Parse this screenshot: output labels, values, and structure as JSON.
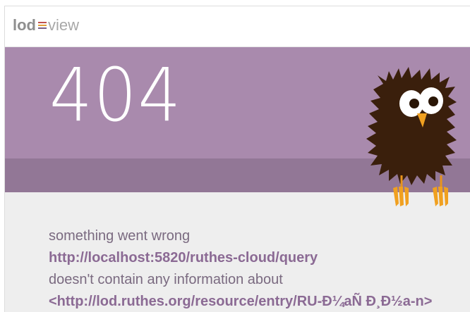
{
  "header": {
    "logo_left": "lod",
    "logo_right": "view",
    "logo_mark_colors": [
      "#c0504d",
      "#e3a13b",
      "#7b5f86"
    ]
  },
  "hero": {
    "error_code": "404",
    "background_color": "#a98aad",
    "band_color": "#927796",
    "mascot": "owl-icon"
  },
  "message": {
    "line1": "something went wrong",
    "line2": "http://localhost:5820/ruthes-cloud/query",
    "line3": "doesn't contain any information about",
    "line4": "<http://lod.ruthes.org/resource/entry/RU-Ð¼aÑ    Ð¸Ð½a-n>"
  }
}
